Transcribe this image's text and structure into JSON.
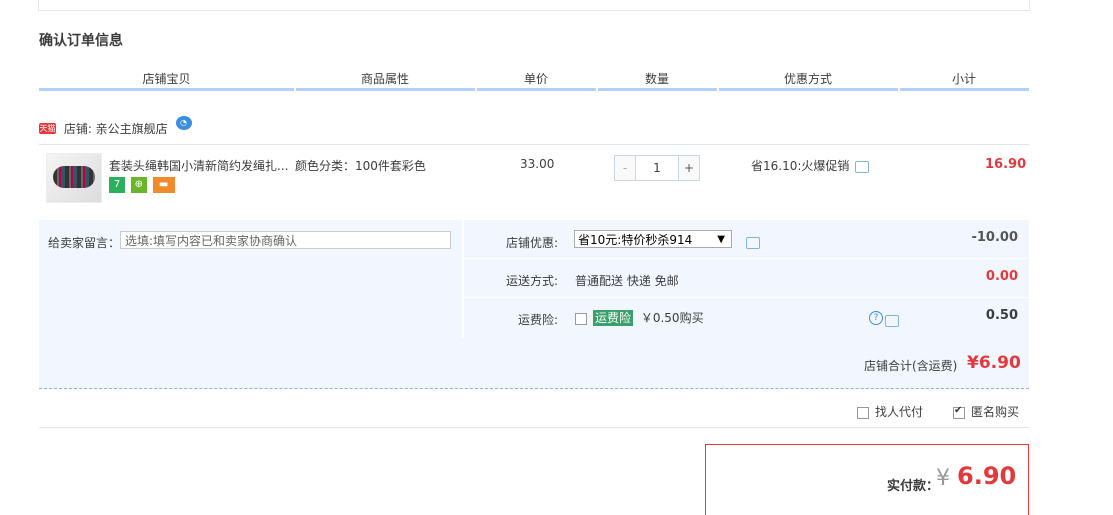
{
  "section": {
    "title": "确认订单信息"
  },
  "columns": [
    "店铺宝贝",
    "商品属性",
    "单价",
    "数量",
    "优惠方式",
    "小计"
  ],
  "shop": {
    "tag": "天猫",
    "label": "店铺: 亲公主旗舰店"
  },
  "item": {
    "title": "套装头绳韩国小清新简约发绳扎...",
    "attr": "颜色分类：100件套彩色",
    "price": "33.00",
    "quantity": "1",
    "minus": "-",
    "plus": "+",
    "promo": "省16.10:火爆促销",
    "subtotal": "16.90",
    "icons": [
      "seven-day-return-icon",
      "guarantee-icon",
      "credit-card-icon"
    ],
    "icon_glyphs": [
      "7",
      "⊕",
      "▬"
    ]
  },
  "options": {
    "memo_label": "给卖家留言：",
    "memo_placeholder": "选填:填写内容已和卖家协商确认",
    "shop_discount_label": "店铺优惠:",
    "shop_discount_selected": "省10元:特价秒杀914",
    "shop_discount_value": "-10.00",
    "shipping_label": "运送方式:",
    "shipping_value_text": "普通配送 快递 免邮",
    "shipping_value": "0.00",
    "insurance_label": "运费险:",
    "insurance_tag": "运费险",
    "insurance_text": "￥0.50购买",
    "insurance_value": "0.50"
  },
  "total": {
    "label": "店铺合计(含运费)",
    "value": "¥6.90"
  },
  "payment_options": {
    "proxy_pay": "找人代付",
    "anonymous": "匿名购买",
    "anonymous_checked": true,
    "proxy_checked": false
  },
  "pay": {
    "label": "实付款：",
    "yen": "¥",
    "value": "6.90"
  },
  "colors": {
    "accent_red": "#e4393c",
    "header_line": "#b2d1ff",
    "band_bg": "#f2f7ff"
  }
}
